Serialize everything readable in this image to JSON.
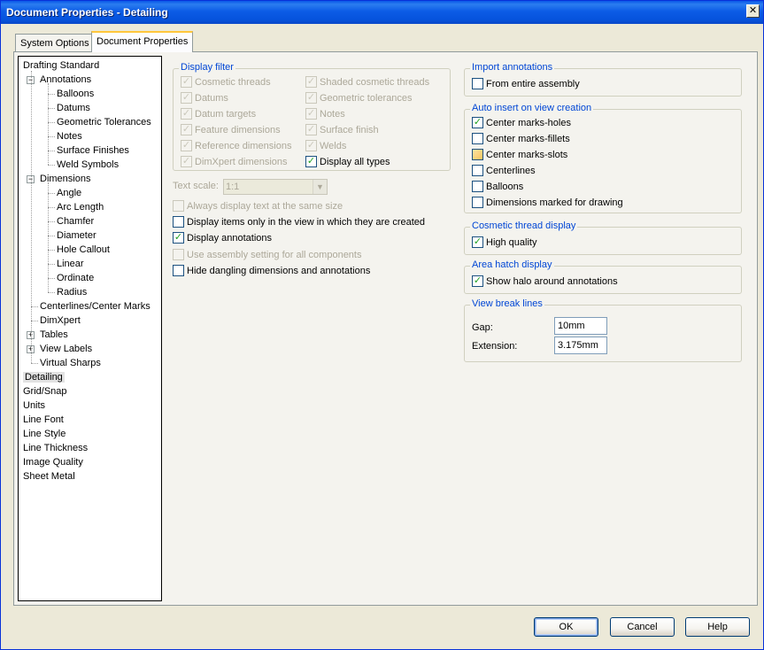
{
  "window": {
    "title": "Document Properties - Detailing",
    "close_glyph": "✕"
  },
  "tabs": [
    {
      "label": "System Options",
      "active": false
    },
    {
      "label": "Document Properties",
      "active": true
    }
  ],
  "tree": {
    "items": [
      {
        "label": "Drafting Standard"
      },
      {
        "label": "Annotations",
        "expander": "−"
      },
      {
        "label": "Balloons"
      },
      {
        "label": "Datums"
      },
      {
        "label": "Geometric Tolerances"
      },
      {
        "label": "Notes"
      },
      {
        "label": "Surface Finishes"
      },
      {
        "label": "Weld Symbols"
      },
      {
        "label": "Dimensions",
        "expander": "−"
      },
      {
        "label": "Angle"
      },
      {
        "label": "Arc Length"
      },
      {
        "label": "Chamfer"
      },
      {
        "label": "Diameter"
      },
      {
        "label": "Hole Callout"
      },
      {
        "label": "Linear"
      },
      {
        "label": "Ordinate"
      },
      {
        "label": "Radius"
      },
      {
        "label": "Centerlines/Center Marks"
      },
      {
        "label": "DimXpert"
      },
      {
        "label": "Tables",
        "expander": "+"
      },
      {
        "label": "View Labels",
        "expander": "+"
      },
      {
        "label": "Virtual Sharps"
      },
      {
        "label": "Detailing",
        "selected": true
      },
      {
        "label": "Grid/Snap"
      },
      {
        "label": "Units"
      },
      {
        "label": "Line Font"
      },
      {
        "label": "Line Style"
      },
      {
        "label": "Line Thickness"
      },
      {
        "label": "Image Quality"
      },
      {
        "label": "Sheet Metal"
      }
    ]
  },
  "display_filter": {
    "legend": "Display filter",
    "left": [
      {
        "label": "Cosmetic threads",
        "checked": true,
        "disabled": true
      },
      {
        "label": "Datums",
        "checked": true,
        "disabled": true
      },
      {
        "label": "Datum targets",
        "checked": true,
        "disabled": true
      },
      {
        "label": "Feature dimensions",
        "checked": true,
        "disabled": true
      },
      {
        "label": "Reference dimensions",
        "checked": true,
        "disabled": true
      },
      {
        "label": "DimXpert dimensions",
        "checked": true,
        "disabled": true
      }
    ],
    "right": [
      {
        "label": "Shaded cosmetic threads",
        "checked": true,
        "disabled": true
      },
      {
        "label": "Geometric tolerances",
        "checked": true,
        "disabled": true
      },
      {
        "label": "Notes",
        "checked": true,
        "disabled": true
      },
      {
        "label": "Surface finish",
        "checked": true,
        "disabled": true
      },
      {
        "label": "Welds",
        "checked": true,
        "disabled": true
      },
      {
        "label": "Display all types",
        "checked": true,
        "disabled": false
      }
    ]
  },
  "text_scale": {
    "label": "Text scale:",
    "value": "1:1",
    "disabled": true
  },
  "options": [
    {
      "label": "Always display text at the same size",
      "checked": false,
      "disabled": true
    },
    {
      "label": "Display items only in the view in which they are created",
      "checked": false,
      "disabled": false
    },
    {
      "label": "Display annotations",
      "checked": true,
      "disabled": false
    },
    {
      "label": "Use assembly setting for all components",
      "checked": false,
      "disabled": true
    },
    {
      "label": "Hide dangling dimensions and annotations",
      "checked": false,
      "disabled": false
    }
  ],
  "import_annotations": {
    "legend": "Import annotations",
    "items": [
      {
        "label": "From entire assembly",
        "checked": false
      }
    ]
  },
  "auto_insert": {
    "legend": "Auto insert on view creation",
    "items": [
      {
        "label": "Center marks-holes",
        "checked": true
      },
      {
        "label": "Center marks-fillets",
        "checked": false
      },
      {
        "label": "Center marks-slots",
        "checked": false,
        "hover": true
      },
      {
        "label": "Centerlines",
        "checked": false
      },
      {
        "label": "Balloons",
        "checked": false
      },
      {
        "label": "Dimensions marked for drawing",
        "checked": false
      }
    ]
  },
  "cosmetic_thread": {
    "legend": "Cosmetic thread display",
    "items": [
      {
        "label": "High quality",
        "checked": true
      }
    ]
  },
  "area_hatch": {
    "legend": "Area hatch display",
    "items": [
      {
        "label": "Show halo around annotations",
        "checked": true
      }
    ]
  },
  "view_break": {
    "legend": "View break lines",
    "gap_label": "Gap:",
    "gap_value": "10mm",
    "extension_label": "Extension:",
    "extension_value": "3.175mm"
  },
  "buttons": {
    "ok": "OK",
    "cancel": "Cancel",
    "help": "Help"
  },
  "check_glyph": "✓"
}
